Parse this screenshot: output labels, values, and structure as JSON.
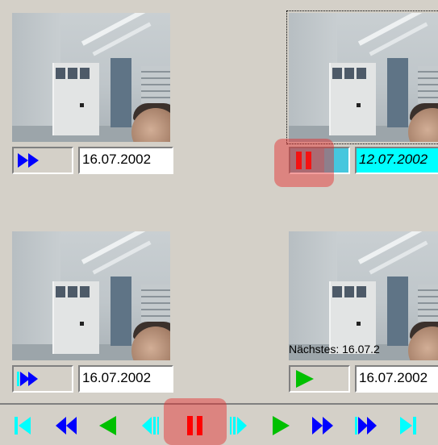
{
  "panels": [
    {
      "id": "p1",
      "date": "16.07.2002",
      "overlay": "",
      "playback": "fast-forward",
      "selected": false
    },
    {
      "id": "p2",
      "date": "12.07.2002",
      "overlay": "",
      "playback": "pause",
      "selected": true
    },
    {
      "id": "p3",
      "date": "16.07.2002",
      "overlay": "",
      "playback": "skip-forward",
      "selected": false
    },
    {
      "id": "p4",
      "date": "16.07.2002",
      "overlay": "Nächstes: 16.07.2",
      "playback": "play",
      "selected": false
    }
  ],
  "toolbar": {
    "buttons": [
      "go-to-start",
      "fast-rewind",
      "play-reverse",
      "step-back",
      "pause",
      "step-forward",
      "play",
      "fast-forward",
      "skip-forward",
      "go-to-end"
    ]
  },
  "colors": {
    "background": "#d4d0c8",
    "active_field": "#00ffff",
    "icon_blue": "#0000ff",
    "icon_cyan": "#00ffff",
    "icon_green": "#00c000",
    "pause_red": "#ff0000",
    "highlight": "#e63232"
  }
}
